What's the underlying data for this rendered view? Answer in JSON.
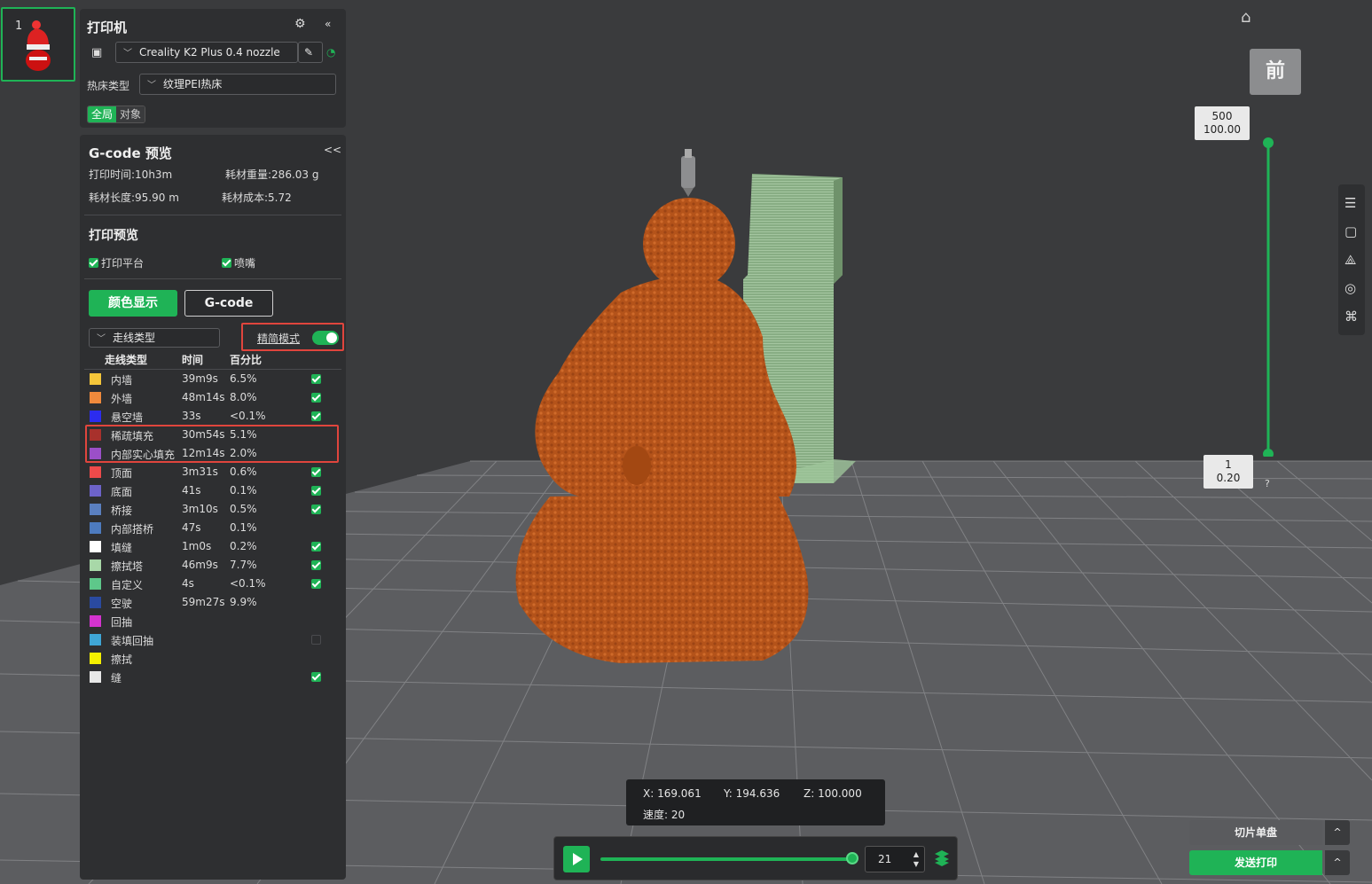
{
  "thumbnail": {
    "plate_number": "1"
  },
  "printer_panel": {
    "title": "打印机",
    "printer_name": "Creality K2 Plus 0.4 nozzle",
    "bed_type_label": "热床类型",
    "bed_type_value": "纹理PEI热床",
    "scope_tabs": [
      "全局",
      "对象"
    ],
    "scope_active": "全局"
  },
  "gcode_panel": {
    "title": "G-code 预览",
    "print_time": "打印时间:10h3m",
    "filament_weight": "耗材重量:286.03 g",
    "filament_length": "耗材长度:95.90 m",
    "filament_cost": "耗材成本:5.72",
    "preview_title": "打印预览",
    "show_bed_label": "打印平台",
    "show_nozzle_label": "喷嘴",
    "btn_color": "颜色显示",
    "btn_gcode": "G-code",
    "view_type": "走线类型",
    "simple_mode_label": "精简模式",
    "simple_mode_on": true,
    "table_headers": [
      "走线类型",
      "时间",
      "百分比"
    ],
    "rows": [
      {
        "name": "内墙",
        "time": "39m9s",
        "percent": "6.5%",
        "color": "#f5c63a",
        "checked": true
      },
      {
        "name": "外墙",
        "time": "48m14s",
        "percent": "8.0%",
        "color": "#f08a3c",
        "checked": true
      },
      {
        "name": "悬空墙",
        "time": "33s",
        "percent": "<0.1%",
        "color": "#2c2cef",
        "checked": true
      },
      {
        "name": "稀疏填充",
        "time": "30m54s",
        "percent": "5.1%",
        "color": "#a8312c",
        "checked": false
      },
      {
        "name": "内部实心填充",
        "time": "12m14s",
        "percent": "2.0%",
        "color": "#9b4fc8",
        "checked": false
      },
      {
        "name": "顶面",
        "time": "3m31s",
        "percent": "0.6%",
        "color": "#ee4a4a",
        "checked": true
      },
      {
        "name": "底面",
        "time": "41s",
        "percent": "0.1%",
        "color": "#6d63c9",
        "checked": true
      },
      {
        "name": "桥接",
        "time": "3m10s",
        "percent": "0.5%",
        "color": "#5a7fbf",
        "checked": true
      },
      {
        "name": "内部搭桥",
        "time": "47s",
        "percent": "0.1%",
        "color": "#4d7bbf",
        "checked": false
      },
      {
        "name": "填缝",
        "time": "1m0s",
        "percent": "0.2%",
        "color": "#ffffff",
        "checked": true
      },
      {
        "name": "擦拭塔",
        "time": "46m9s",
        "percent": "7.7%",
        "color": "#a8d8a8",
        "checked": true
      },
      {
        "name": "自定义",
        "time": "4s",
        "percent": "<0.1%",
        "color": "#5ec88a",
        "checked": true
      },
      {
        "name": "空驶",
        "time": "59m27s",
        "percent": "9.9%",
        "color": "#2a4aa0",
        "checked": false
      },
      {
        "name": "回抽",
        "time": "",
        "percent": "",
        "color": "#d433cf",
        "checked": false
      },
      {
        "name": "装填回抽",
        "time": "",
        "percent": "",
        "color": "#3fa6d6",
        "checked": false,
        "empty_box": true
      },
      {
        "name": "擦拭",
        "time": "",
        "percent": "",
        "color": "#f5f000",
        "checked": false
      },
      {
        "name": "缝",
        "time": "",
        "percent": "",
        "color": "#e8e8e8",
        "checked": true
      }
    ]
  },
  "view_cube": {
    "face": "前"
  },
  "layer_slider": {
    "top_layer": "500",
    "top_height": "100.00",
    "bottom_layer": "1",
    "bottom_height": "0.20",
    "help": "?"
  },
  "coords": {
    "x": "X: 169.061",
    "y": "Y: 194.636",
    "z": "Z: 100.000",
    "speed": "速度: 20"
  },
  "playback": {
    "move_value": "21",
    "progress": 1.0
  },
  "actions": {
    "slice_label": "切片单盘",
    "send_label": "发送打印",
    "caret": "^"
  },
  "colors": {
    "accent": "#1fb356",
    "highlight_box": "#e0453d",
    "model": "#b9561a",
    "wipe_tower": "#8fb38a"
  }
}
